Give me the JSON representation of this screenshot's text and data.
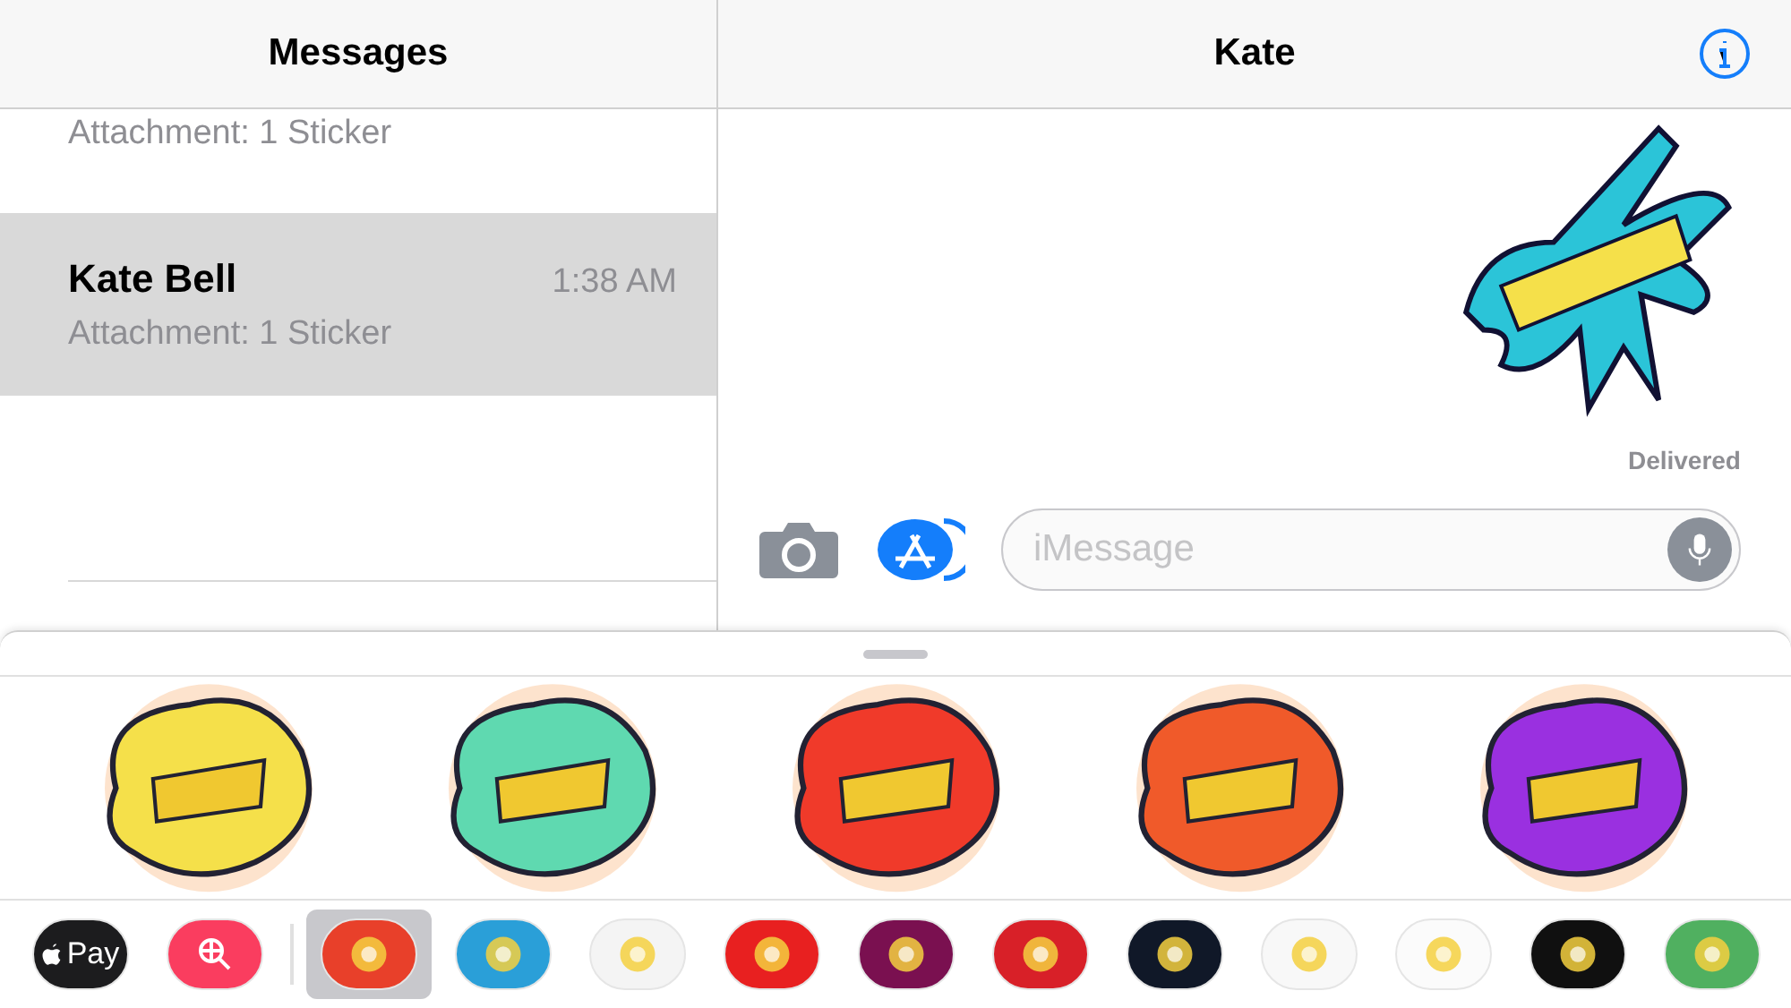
{
  "sidebar": {
    "title": "Messages",
    "conversations": [
      {
        "preview": "Attachment: 1 Sticker",
        "selected": false
      },
      {
        "name": "Kate Bell",
        "preview": "Attachment: 1 Sticker",
        "time": "1:38 AM",
        "selected": true
      }
    ]
  },
  "chat": {
    "title": "Kate",
    "status": "Delivered",
    "input": {
      "placeholder": "iMessage"
    }
  },
  "stickers": [
    {
      "color": "#f5e04a"
    },
    {
      "color": "#5fd9b0"
    },
    {
      "color": "#f03a2a"
    },
    {
      "color": "#f05a2a"
    },
    {
      "color": "#9a30e0"
    }
  ],
  "apps": [
    {
      "kind": "pay",
      "label": "Pay",
      "color": "#1c1c1e",
      "selected": false
    },
    {
      "kind": "search",
      "color": "#fa3d5f",
      "selected": false
    },
    {
      "kind": "art",
      "color": "#e8402a",
      "selected": true
    },
    {
      "kind": "art",
      "color": "#2a9fd8",
      "selected": false
    },
    {
      "kind": "art",
      "color": "#f4f4f4",
      "selected": false
    },
    {
      "kind": "art",
      "color": "#e82020",
      "selected": false
    },
    {
      "kind": "art",
      "color": "#7a1050",
      "selected": false
    },
    {
      "kind": "art",
      "color": "#d82028",
      "selected": false
    },
    {
      "kind": "art",
      "color": "#101828",
      "selected": false
    },
    {
      "kind": "art",
      "color": "#f8f8f8",
      "selected": false
    },
    {
      "kind": "art",
      "color": "#fbfbfb",
      "selected": false
    },
    {
      "kind": "art",
      "color": "#101010",
      "selected": false
    },
    {
      "kind": "art",
      "color": "#50b060",
      "selected": false
    }
  ]
}
